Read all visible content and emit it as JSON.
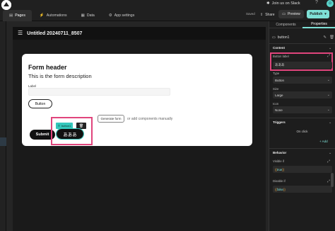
{
  "topbar": {
    "tabs": [
      {
        "label": "Pages",
        "icon": "pages-icon"
      },
      {
        "label": "Automations",
        "icon": "automations-icon"
      },
      {
        "label": "Data",
        "icon": "data-icon"
      },
      {
        "label": "App settings",
        "icon": "settings-icon"
      }
    ],
    "join_label": "Join us on Slack",
    "saved_label": "Saved",
    "share_label": "Share",
    "preview_label": "Preview",
    "publish_label": "Publish"
  },
  "app": {
    "title": "Untitled 20240711_8507"
  },
  "form": {
    "header": "Form header",
    "description": "This is the form description",
    "field_label": "Label",
    "field_value": "",
    "button_label": "Button",
    "submit_label": "Submit",
    "generate_label": "Generate form",
    "add_manual_label": "or add components manually",
    "selected_chip_label": "button1",
    "selected_button_label": "あああ"
  },
  "panel": {
    "tabs": [
      "Components",
      "Properties"
    ],
    "component_name": "button1",
    "content_section": "Content",
    "button_label_title": "Button label",
    "button_label_value": "あああ",
    "type_title": "Type",
    "type_value": "Button",
    "size_title": "Size",
    "size_value": "Large",
    "icon_title": "Icon",
    "icon_value": "None",
    "triggers_section": "Triggers",
    "on_click_label": "On click",
    "add_label": "Add",
    "behavior_section": "Behavior",
    "visible_title": "Visible if",
    "visible_value": "true",
    "disable_title": "Disable if",
    "disable_value": "false"
  },
  "colors": {
    "accent": "#7ee0d6",
    "selection": "#e0457c",
    "dark": "#1b1b1b"
  }
}
